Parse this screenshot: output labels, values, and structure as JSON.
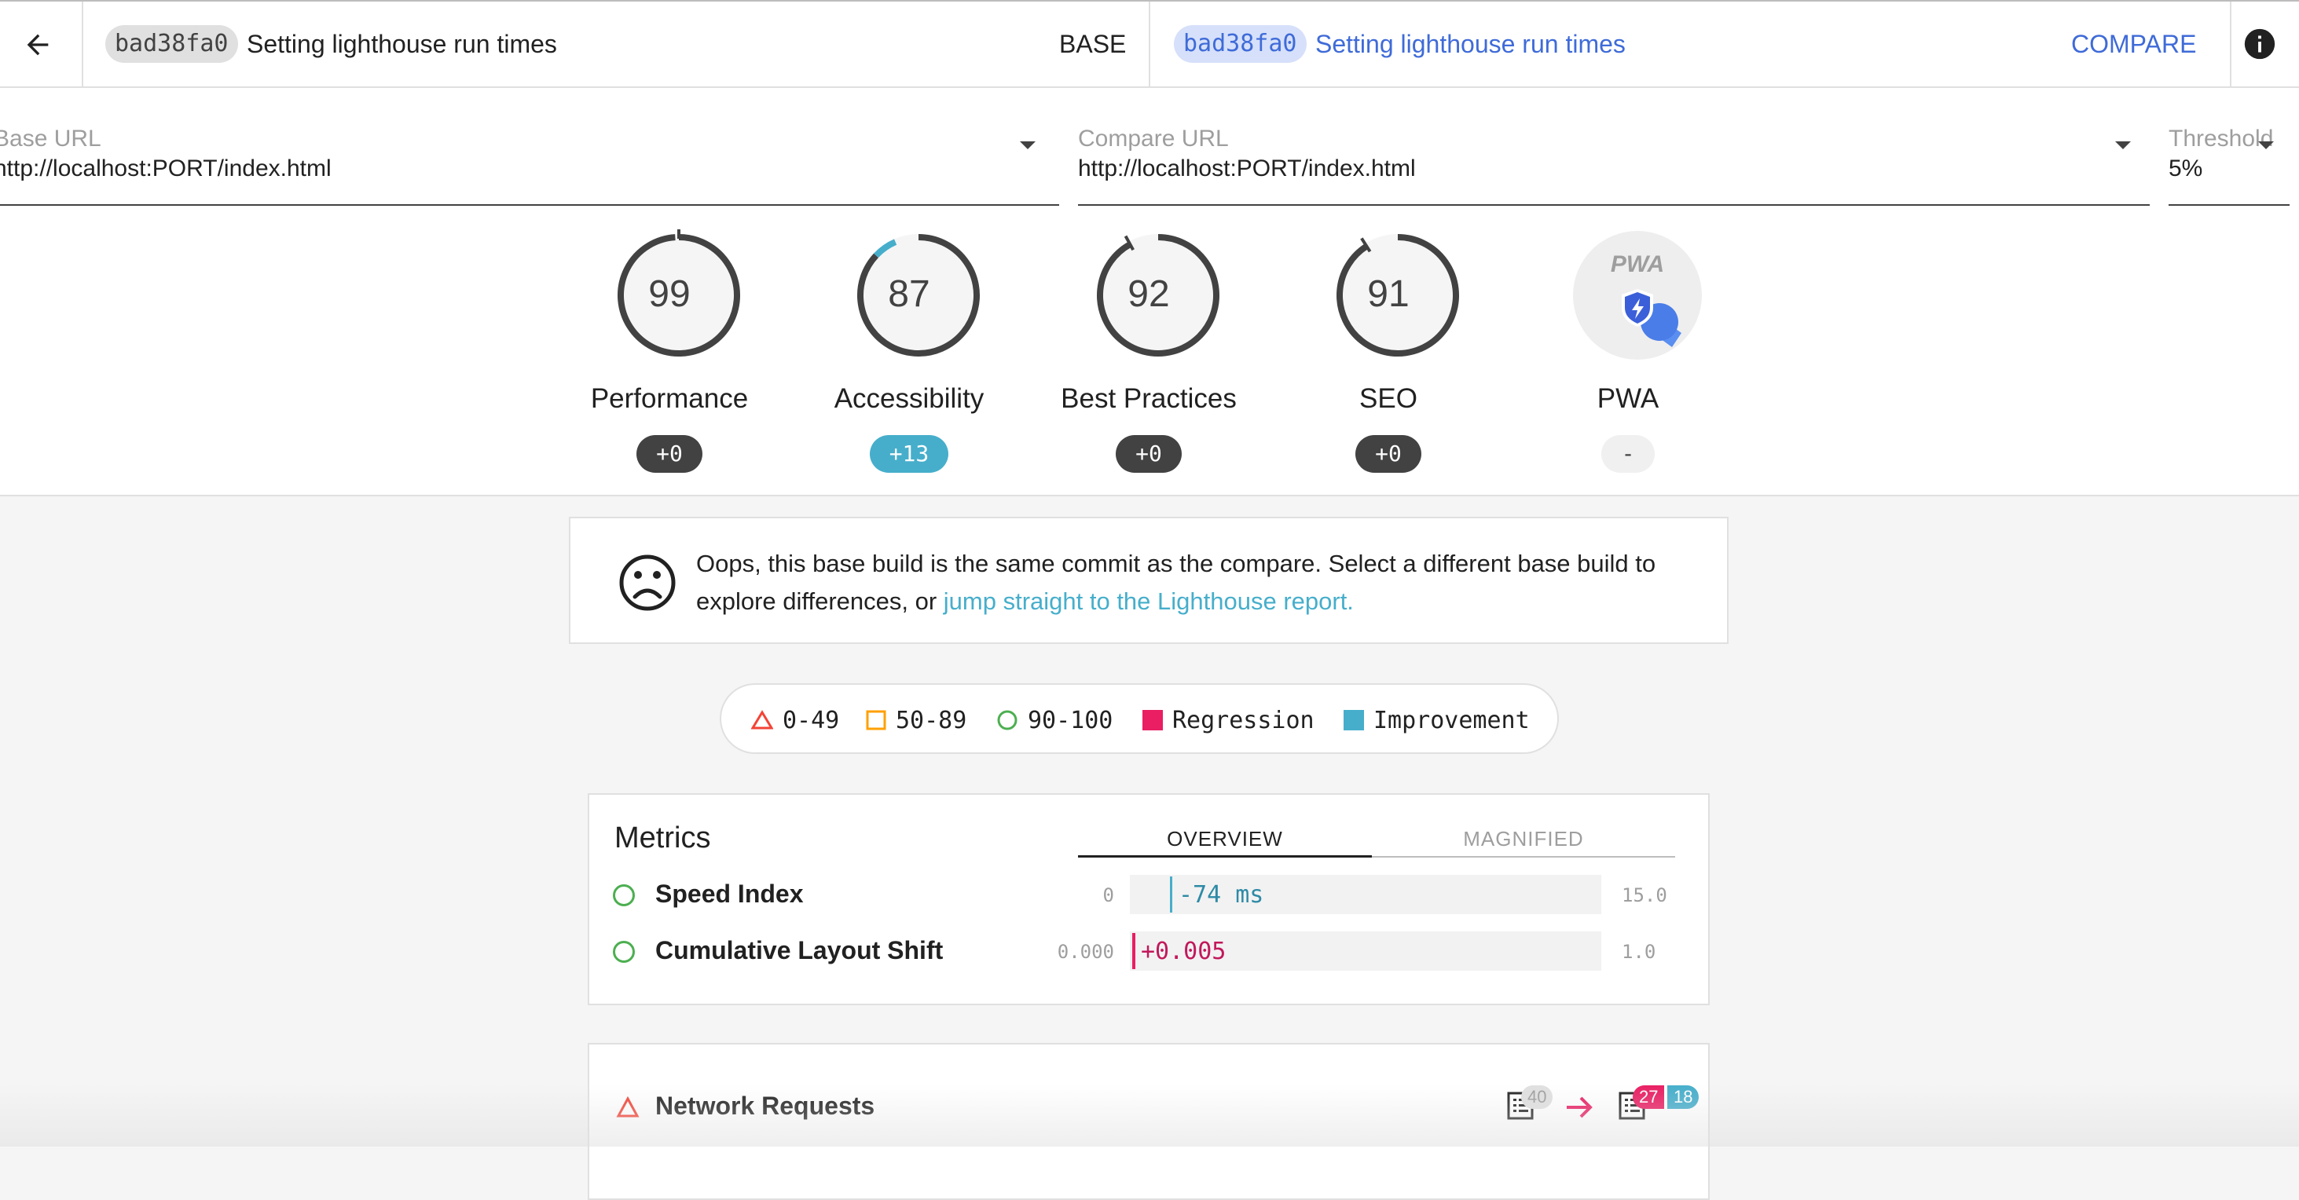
{
  "topbar": {
    "base": {
      "hash": "bad38fa0",
      "title": "Setting lighthouse run times",
      "label": "BASE"
    },
    "compare": {
      "hash": "bad38fa0",
      "title": "Setting lighthouse run times",
      "label": "COMPARE"
    }
  },
  "url_row": {
    "base_url": {
      "label": "Base URL",
      "value": "http://localhost:PORT/index.html"
    },
    "compare_url": {
      "label": "Compare URL",
      "value": "http://localhost:PORT/index.html"
    },
    "threshold": {
      "label": "Threshold",
      "value": "5%"
    }
  },
  "gauges": [
    {
      "label": "Performance",
      "score": "99",
      "delta": "+0",
      "fill": 0.99
    },
    {
      "label": "Accessibility",
      "score": "87",
      "delta": "+13",
      "fill": 0.87,
      "improved_fill": 0.13
    },
    {
      "label": "Best Practices",
      "score": "92",
      "delta": "+0",
      "fill": 0.92
    },
    {
      "label": "SEO",
      "score": "91",
      "delta": "+0",
      "fill": 0.91
    },
    {
      "label": "PWA",
      "score": "",
      "delta": "-",
      "icon": "pwa-badge-icon",
      "icon_text": "PWA"
    }
  ],
  "notice": {
    "icon": "sad-face-icon",
    "text": "Oops, this base build is the same commit as the compare. Select a different base build to explore differences, or ",
    "link": "jump straight to the Lighthouse report."
  },
  "legend": [
    {
      "label": "0-49",
      "icon": "triangle-icon",
      "color": "#f44336"
    },
    {
      "label": "50-89",
      "icon": "square-icon",
      "color": "#ffa000"
    },
    {
      "label": "90-100",
      "icon": "circle-icon",
      "color": "#4caf50"
    },
    {
      "label": "Regression",
      "icon": "regression-swatch",
      "color": "#e91e63"
    },
    {
      "label": "Improvement",
      "icon": "improvement-swatch",
      "color": "#46aecb"
    }
  ],
  "metrics": {
    "title": "Metrics",
    "tabs": [
      {
        "label": "OVERVIEW",
        "active": true
      },
      {
        "label": "MAGNIFIED",
        "active": false
      }
    ],
    "rows": [
      {
        "name": "Speed Index",
        "min": "0",
        "delta": "-74 ms",
        "max": "15.0",
        "kind": "improvement",
        "fraction": 0.0049
      },
      {
        "name": "Cumulative Layout Shift",
        "min": "0.000",
        "delta": "+0.005",
        "max": "1.0",
        "kind": "regression",
        "fraction": 0.005
      }
    ]
  },
  "network": {
    "name": "Network Requests",
    "base_count": "40",
    "compare_regressions": "27",
    "compare_improvements": "18"
  },
  "colors": {
    "accent_blue": "#3f6bd8",
    "improvement": "#46aecb",
    "regression": "#e91e63",
    "pass": "#4caf50",
    "fail": "#f44336",
    "average": "#ffa000"
  }
}
